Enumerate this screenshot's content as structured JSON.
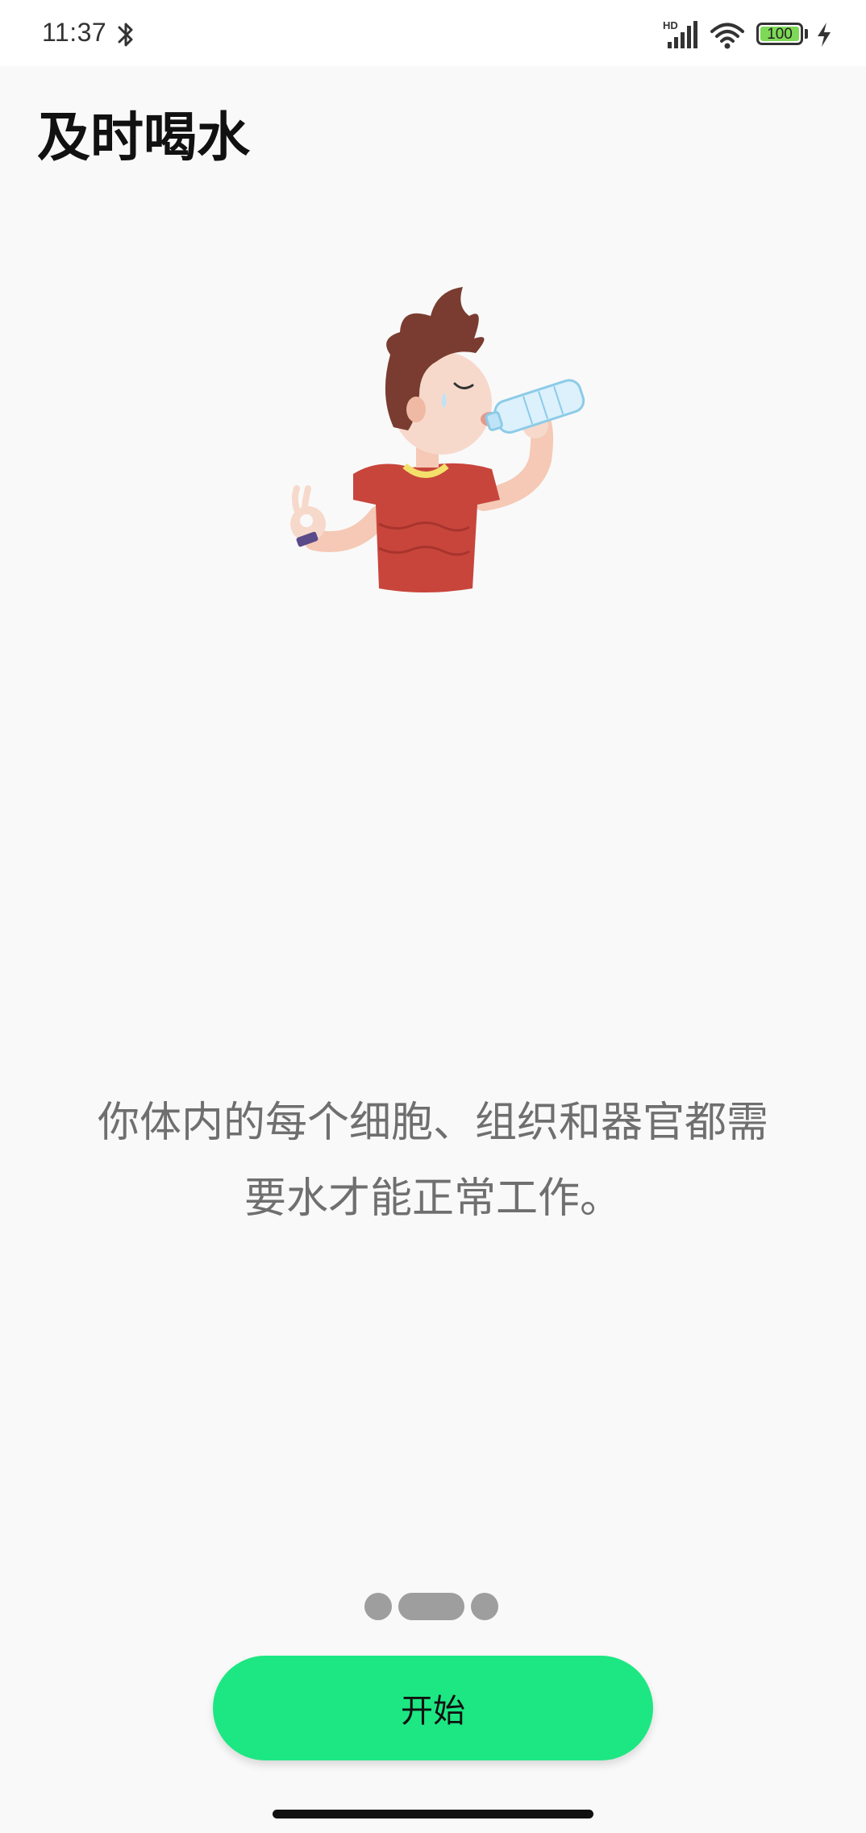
{
  "status_bar": {
    "time": "11:37",
    "network_label": "HD",
    "battery_level": "100",
    "icons": [
      "bluetooth-icon",
      "signal-icon",
      "wifi-icon",
      "battery-icon",
      "charging-icon"
    ]
  },
  "page": {
    "title": "及时喝水",
    "description": "你体内的每个细胞、组织和器官都需要水才能正常工作。",
    "illustration": "person-drinking-water-illustration"
  },
  "pager": {
    "total_pages": 3,
    "active_index": 1
  },
  "actions": {
    "start_label": "开始"
  },
  "colors": {
    "accent": "#1de783",
    "background": "#f9f9f9",
    "title_text": "#111111",
    "body_text": "#6f6f6f",
    "pager_dot": "#9e9e9e"
  }
}
